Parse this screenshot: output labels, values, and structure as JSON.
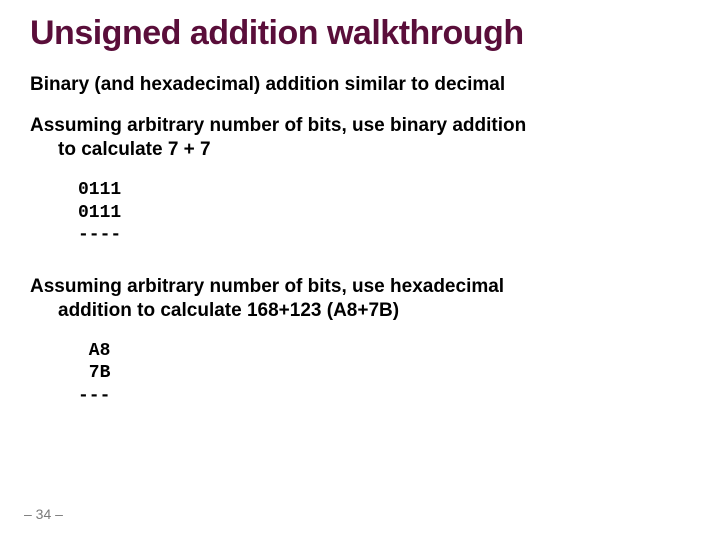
{
  "title": "Unsigned addition walkthrough",
  "p1": "Binary (and hexadecimal) addition similar to decimal",
  "p2a": "Assuming arbitrary number of bits, use binary addition",
  "p2b": "to calculate 7 + 7",
  "code1": "0111\n0111\n----",
  "p3a": "Assuming arbitrary number of bits, use hexadecimal",
  "p3b": "addition to calculate 168+123 (A8+7B)",
  "code2": " A8\n 7B\n---",
  "pagenum": "– 34 –",
  "chart_data": {
    "type": "table",
    "title": "Unsigned addition walkthrough",
    "examples": [
      {
        "base": "binary",
        "operands_decimal": [
          7,
          7
        ],
        "operands_shown": [
          "0111",
          "0111"
        ],
        "separator": "----"
      },
      {
        "base": "hexadecimal",
        "operands_decimal": [
          168,
          123
        ],
        "operands_shown": [
          "A8",
          "7B"
        ],
        "separator": "---"
      }
    ]
  }
}
